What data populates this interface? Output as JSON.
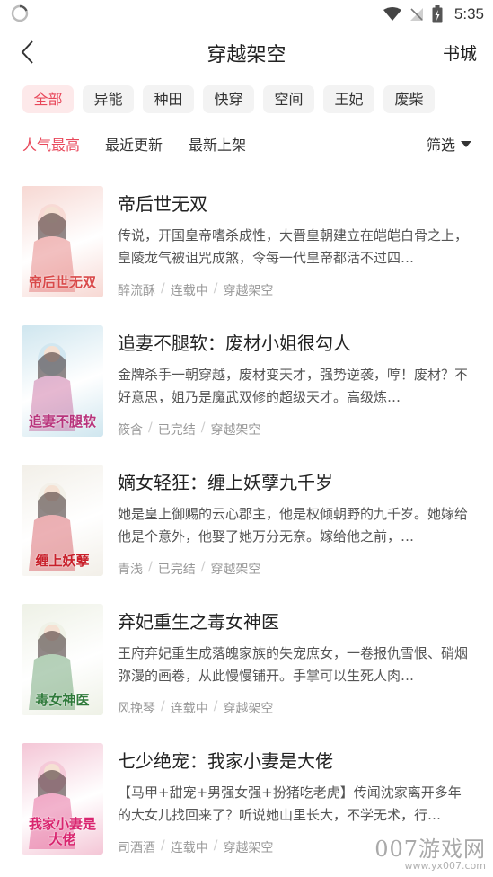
{
  "status": {
    "time": "5:35"
  },
  "header": {
    "title": "穿越架空",
    "right_label": "书城"
  },
  "tags": [
    "全部",
    "异能",
    "种田",
    "快穿",
    "空间",
    "王妃",
    "废柴"
  ],
  "active_tag": "全部",
  "sort": {
    "options": [
      "人气最高",
      "最近更新",
      "最新上架"
    ],
    "active": "人气最高",
    "filter_label": "筛选"
  },
  "books": [
    {
      "title": "帝后世无双",
      "desc": "传说，开国皇帝嗜杀成性，大晋皇朝建立在皑皑白骨之上，皇陵龙气被诅咒成煞，令每一代皇帝都活不过四…",
      "author": "醉流酥",
      "status": "连载中",
      "category": "穿越架空",
      "cover_text": "帝后世无双",
      "cover_colors": [
        "#f7d8d3",
        "#d94a4a"
      ]
    },
    {
      "title": "追妻不腿软：废材小姐很勾人",
      "desc": "金牌杀手一朝穿越，废材变天才，强势逆袭，哼！废材？不好意思，姐乃是魔武双修的超级天才。高级炼…",
      "author": "筱含",
      "status": "已完结",
      "category": "穿越架空",
      "cover_text": "追妻不腿软",
      "cover_colors": [
        "#cfe6ef",
        "#b8347c"
      ]
    },
    {
      "title": "嫡女轻狂：缠上妖孽九千岁",
      "desc": "她是皇上御赐的云心郡主，他是权倾朝野的九千岁。她嫁给他是个意外，他娶了她万分无奈。嫁给他之前，…",
      "author": "青浅",
      "status": "已完结",
      "category": "穿越架空",
      "cover_text": "缠上妖孽",
      "cover_colors": [
        "#f2efe8",
        "#c8202a"
      ]
    },
    {
      "title": "弃妃重生之毒女神医",
      "desc": "王府弃妃重生成落魄家族的失宠庶女，一卷报仇雪恨、硝烟弥漫的画卷，从此慢慢铺开。手掌可以生死人肉…",
      "author": "风挽琴",
      "status": "连载中",
      "category": "穿越架空",
      "cover_text": "毒女神医",
      "cover_colors": [
        "#eef1e6",
        "#2f7a3a"
      ]
    },
    {
      "title": "七少绝宠：我家小妻是大佬",
      "desc": "【马甲+甜宠+男强女强+扮猪吃老虎】传闻沈家离开多年的大女儿找回来了？听说她山里长大，不学无术，行…",
      "author": "司酒酒",
      "status": "连载中",
      "category": "穿越架空",
      "cover_text": "我家小妻是大佬",
      "cover_colors": [
        "#f4c6d6",
        "#d9256f"
      ]
    }
  ],
  "watermark": {
    "main": "007游戏网",
    "url": "www.yx007.com"
  }
}
